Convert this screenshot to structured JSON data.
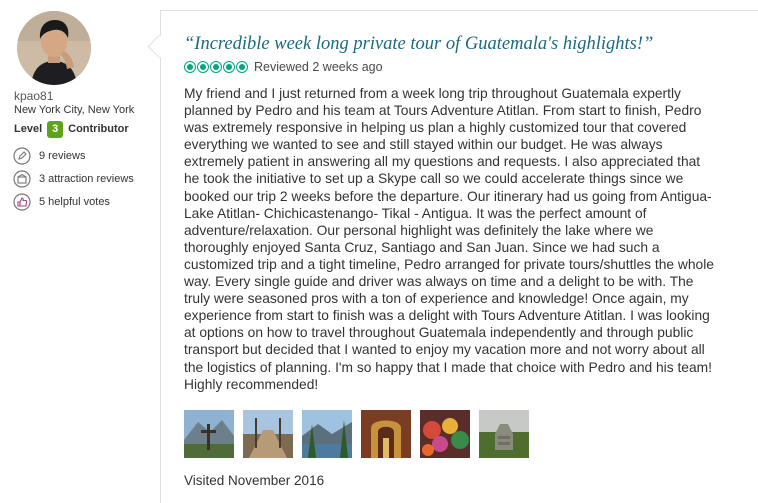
{
  "member": {
    "username": "kpao81",
    "location": "New York City, New York",
    "level_prefix": "Level",
    "level_number": "3",
    "level_suffix": "Contributor",
    "stats": [
      {
        "icon": "pen-icon",
        "label": "9 reviews"
      },
      {
        "icon": "attraction-icon",
        "label": "3 attraction reviews"
      },
      {
        "icon": "thumbs-up-icon",
        "label": "5 helpful votes"
      }
    ]
  },
  "review": {
    "title": "“Incredible week long private tour of Guatemala's highlights!”",
    "rating": 5,
    "rating_max": 5,
    "reviewed_date": "Reviewed 2 weeks ago",
    "body": "My friend and I just returned from a week long trip throughout Guatemala expertly planned by Pedro and his team at Tours Adventure Atitlan. From start to finish, Pedro was extremely responsive in helping us plan a highly customized tour that covered everything we wanted to see and still stayed within our budget. He was always extremely patient in answering all my questions and requests. I also appreciated that he took the initiative to set up a Skype call so we could accelerate things since we booked our trip 2 weeks before the departure. Our itinerary had us going from Antigua- Lake Atitlan- Chichicastenango- Tikal - Antigua. It was the perfect amount of adventure/relaxation. Our personal highlight was definitely the lake where we thoroughly enjoyed Santa Cruz, Santiago and San Juan. Since we had such a customized trip and a tight timeline, Pedro arranged for private tours/shuttles the whole way. Every single guide and driver was always on time and a delight to be with. The truly were seasoned pros with a ton of experience and knowledge! Once again, my experience from start to finish was a delight with Tours Adventure Atitlan. I was looking at options on how to travel throughout Guatemala independently and through public transport but decided that I wanted to enjoy my vacation more and not worry about all the logistics of planning. I'm so happy that I made that choice with Pedro and his team! Highly recommended!",
    "visited": "Visited November 2016",
    "photo_count": 6
  },
  "colors": {
    "title": "#1a6b82",
    "bubble": "#00a680",
    "level_badge": "#5ea31c"
  }
}
